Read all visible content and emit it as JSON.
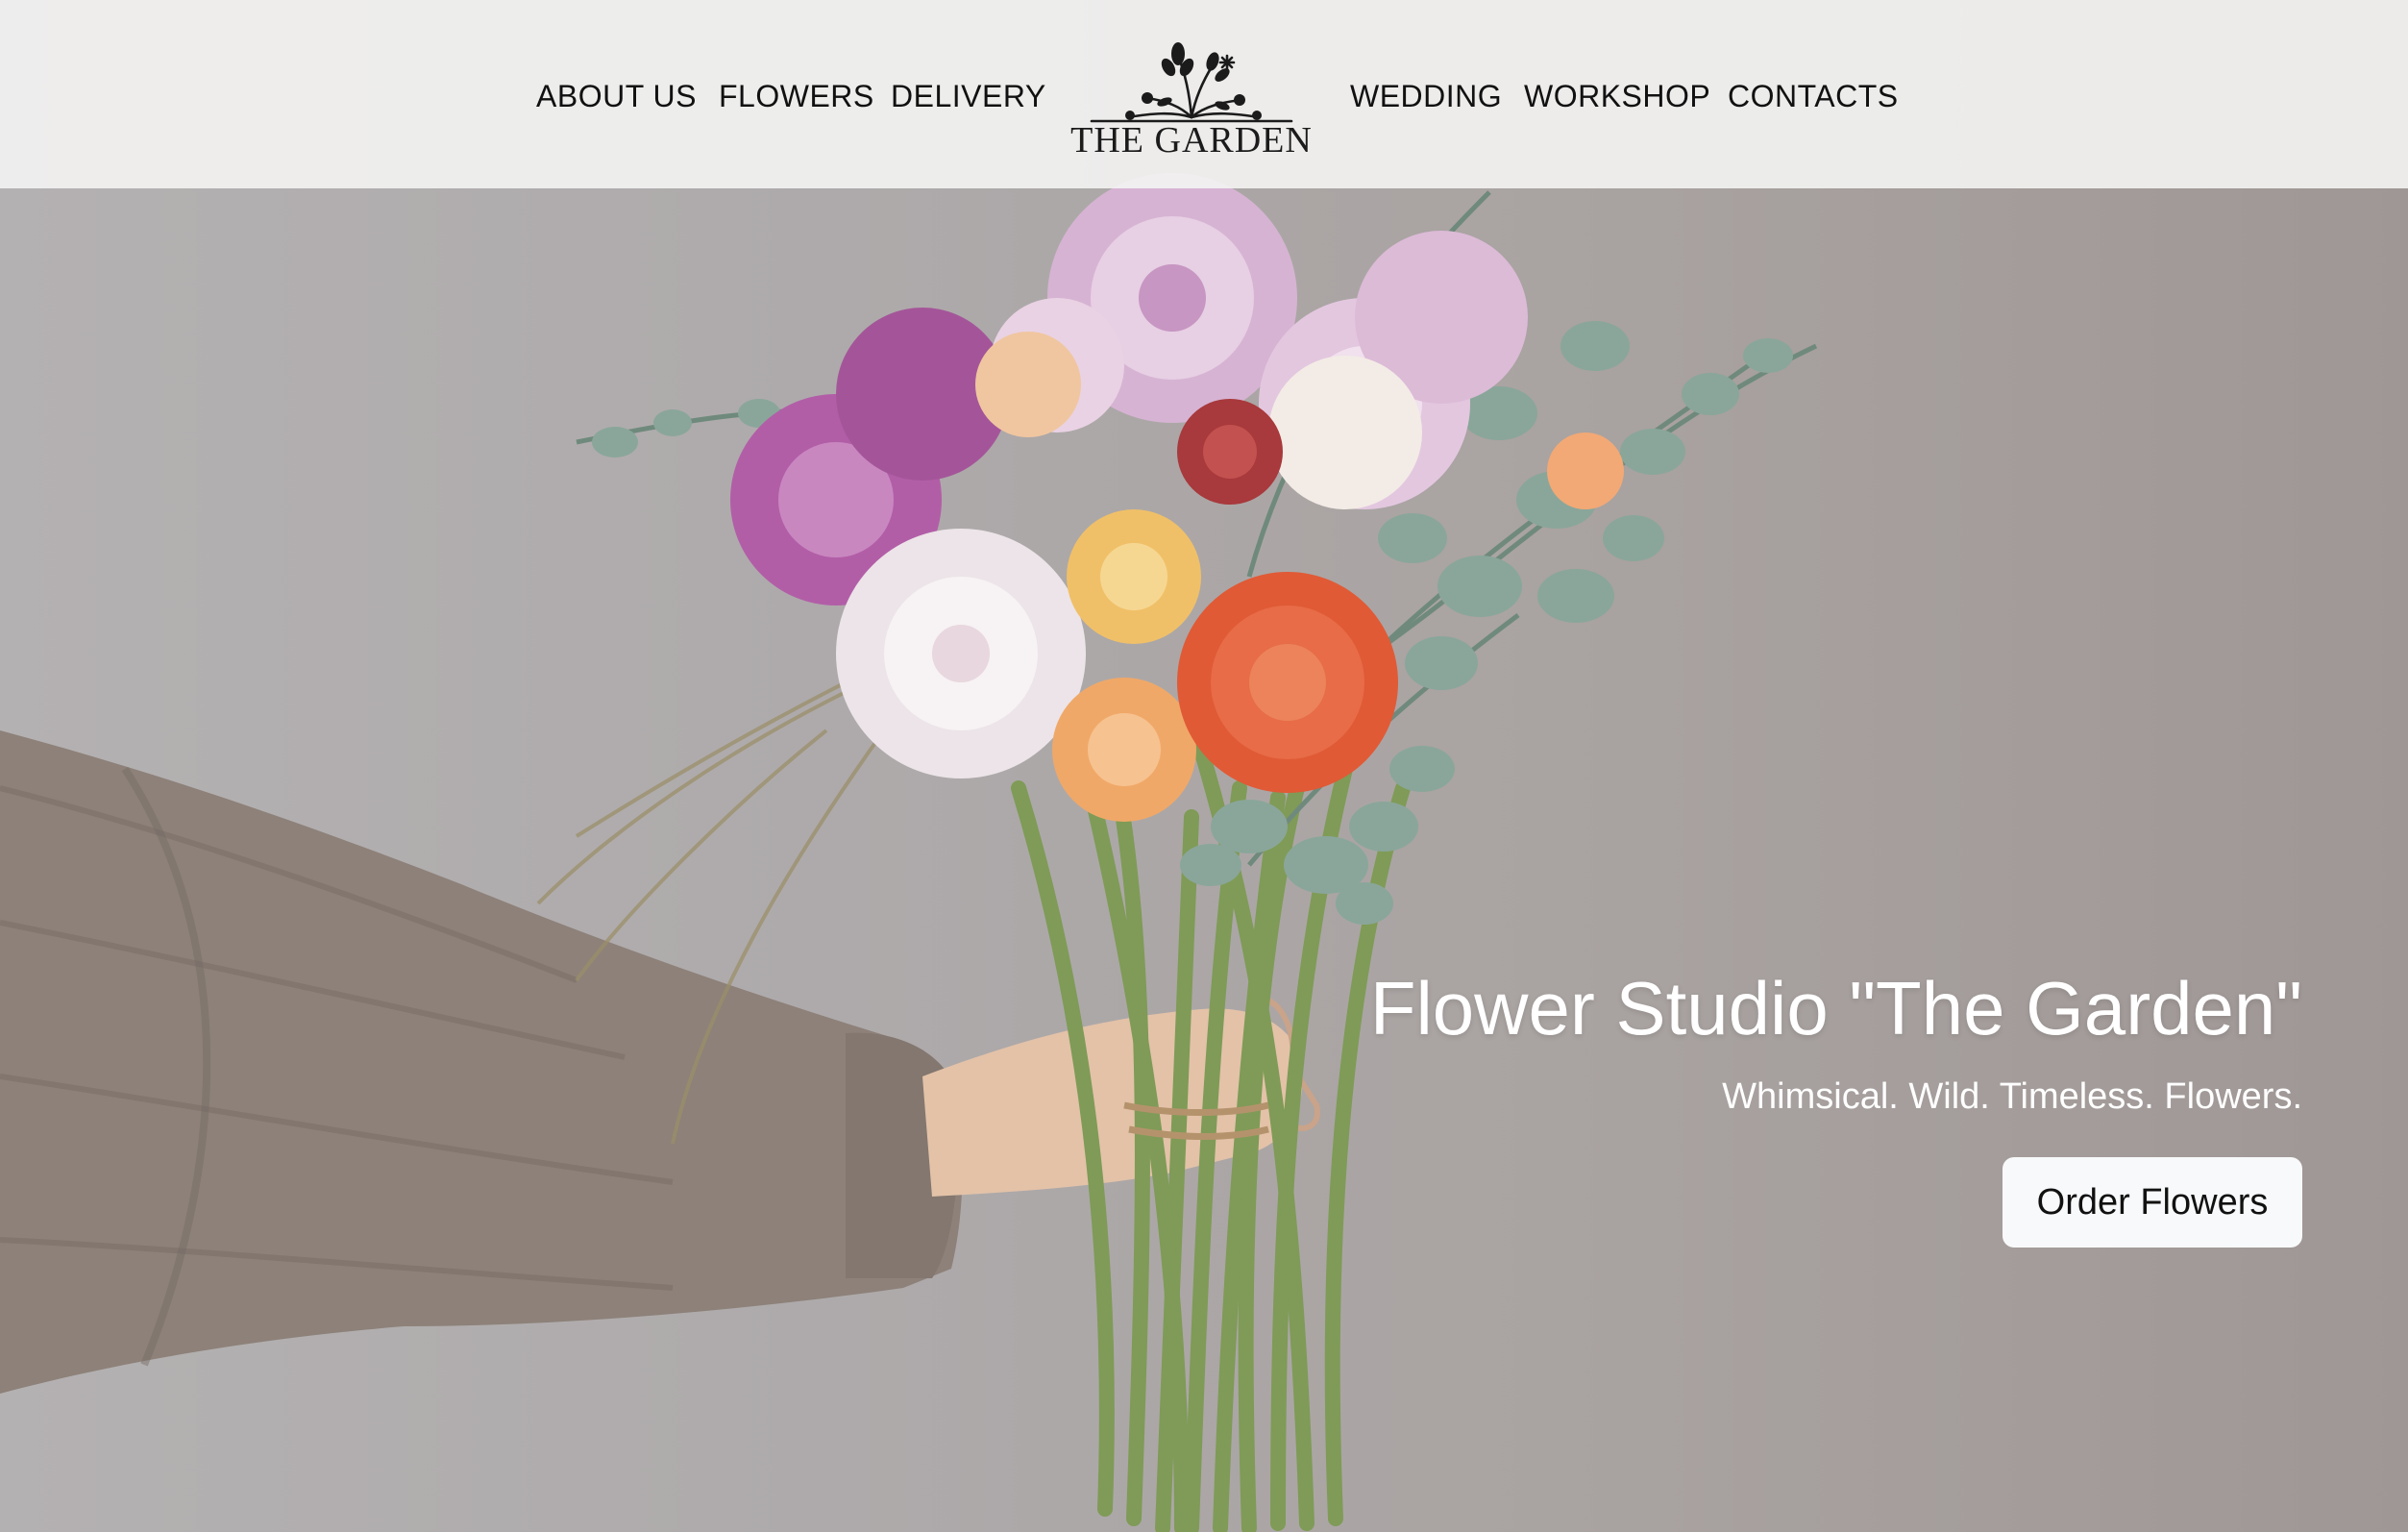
{
  "nav": {
    "left": [
      "ABOUT US",
      "FLOWERS",
      "DELIVERY"
    ],
    "right": [
      "WEDDING",
      "WORKSHOP",
      "CONTACTS"
    ]
  },
  "logo": {
    "text": "THE GARDEN"
  },
  "hero": {
    "title": "Flower Studio \"The Garden\"",
    "subtitle": "Whimsical. Wild. Timeless. Flowers.",
    "cta_label": "Order Flowers"
  },
  "colors": {
    "nav_bg": "#f4f4f3",
    "wall": "#aeaaab",
    "button_bg": "#f8f9fa",
    "dahlia_orange": "#e25b38",
    "dahlia_pink": "#c07ab6",
    "eucalyptus": "#7d968c",
    "sweater": "#8c8078"
  },
  "icons": [
    "flower-logo-icon",
    "bouquet-illustration"
  ]
}
